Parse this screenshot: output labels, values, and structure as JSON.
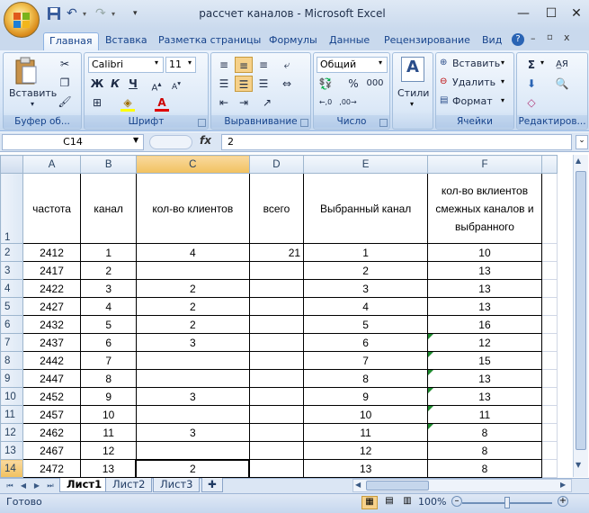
{
  "window": {
    "title": "рассчет каналов - Microsoft Excel"
  },
  "tabs": [
    "Главная",
    "Вставка",
    "Разметка страницы",
    "Формулы",
    "Данные",
    "Рецензирование",
    "Вид"
  ],
  "ribbon": {
    "clipboard": {
      "paste": "Вставить",
      "label": "Буфер об..."
    },
    "font": {
      "name": "Calibri",
      "size": "11",
      "bold": "Ж",
      "italic": "К",
      "underline": "Ч",
      "label": "Шрифт"
    },
    "alignment": {
      "label": "Выравнивание"
    },
    "number": {
      "format": "Общий",
      "percent": "%",
      "thousands": "000",
      "label": "Число"
    },
    "styles": {
      "button": "Стили"
    },
    "cells": {
      "insert": "Вставить",
      "delete": "Удалить",
      "format": "Формат",
      "label": "Ячейки"
    },
    "editing": {
      "label": "Редактиров..."
    }
  },
  "formula_bar": {
    "name_box": "C14",
    "fx": "fx",
    "content": "2"
  },
  "sheet": {
    "columns": [
      "A",
      "B",
      "C",
      "D",
      "E",
      "F"
    ],
    "rows": [
      "1",
      "2",
      "3",
      "4",
      "5",
      "6",
      "7",
      "8",
      "9",
      "10",
      "11",
      "12",
      "13",
      "14"
    ],
    "header_row": [
      "частота",
      "канал",
      "кол-во клиентов",
      "всего",
      "Выбранный канал",
      "кол-во вклиентов смежных каналов и выбранного"
    ],
    "data": [
      [
        "2412",
        "1",
        "4",
        "21",
        "1",
        "10"
      ],
      [
        "2417",
        "2",
        "",
        "",
        "2",
        "13"
      ],
      [
        "2422",
        "3",
        "2",
        "",
        "3",
        "13"
      ],
      [
        "2427",
        "4",
        "2",
        "",
        "4",
        "13"
      ],
      [
        "2432",
        "5",
        "2",
        "",
        "5",
        "16"
      ],
      [
        "2437",
        "6",
        "3",
        "",
        "6",
        "12"
      ],
      [
        "2442",
        "7",
        "",
        "",
        "7",
        "15"
      ],
      [
        "2447",
        "8",
        "",
        "",
        "8",
        "13"
      ],
      [
        "2452",
        "9",
        "3",
        "",
        "9",
        "13"
      ],
      [
        "2457",
        "10",
        "",
        "",
        "10",
        "11"
      ],
      [
        "2462",
        "11",
        "3",
        "",
        "11",
        "8"
      ],
      [
        "2467",
        "12",
        "",
        "",
        "12",
        "8"
      ],
      [
        "2472",
        "13",
        "2",
        "",
        "13",
        "8"
      ]
    ]
  },
  "sheet_tabs": [
    "Лист1",
    "Лист2",
    "Лист3"
  ],
  "status": {
    "ready": "Готово",
    "zoom": "100%"
  }
}
